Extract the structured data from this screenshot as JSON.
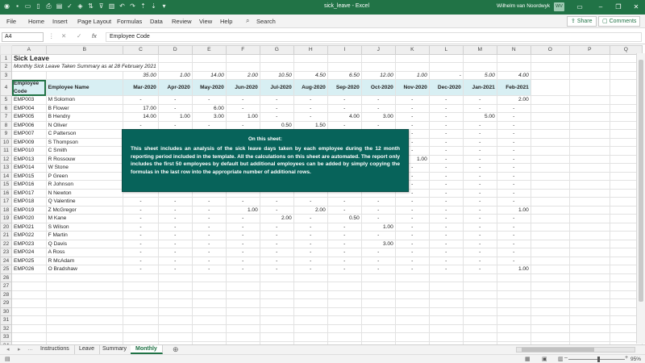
{
  "app": {
    "title": "sick_leave  -  Excel",
    "user_name": "Wilhelm van Noordwyk",
    "user_initials": "WV",
    "accent_color": "#217346"
  },
  "quick_access_icons": [
    "autosave-icon",
    "save-icon",
    "open-icon",
    "new-icon",
    "print-icon",
    "print-preview-icon",
    "spelling-icon",
    "format-icon",
    "sort-icon",
    "filter-icon",
    "chart-icon",
    "undo-icon",
    "redo-icon",
    "sort-asc-icon",
    "sort-desc-icon",
    "more-icon"
  ],
  "menu": {
    "items": [
      "File",
      "Home",
      "Insert",
      "Page Layout",
      "Formulas",
      "Data",
      "Review",
      "View",
      "Help"
    ],
    "search_label": "Search",
    "share_label": "Share",
    "comments_label": "Comments"
  },
  "formula_bar": {
    "name_box": "A4",
    "fx": "fx",
    "content": "Employee Code"
  },
  "columns": [
    "A",
    "B",
    "C",
    "D",
    "E",
    "F",
    "G",
    "H",
    "I",
    "J",
    "K",
    "L",
    "M",
    "N",
    "O",
    "P",
    "Q"
  ],
  "sheet": {
    "title": "Sick Leave",
    "subtitle": "Monthly Sick Leave Taken Summary as at 28 February 2021",
    "totals": [
      "35.00",
      "1.00",
      "14.00",
      "2.00",
      "10.50",
      "4.50",
      "6.50",
      "12.00",
      "1.00",
      "-",
      "5.00",
      "4.00"
    ],
    "header_code": "Employee Code",
    "header_name": "Employee Name",
    "months": [
      "Mar-2020",
      "Apr-2020",
      "May-2020",
      "Jun-2020",
      "Jul-2020",
      "Aug-2020",
      "Sep-2020",
      "Oct-2020",
      "Nov-2020",
      "Dec-2020",
      "Jan-2021",
      "Feb-2021"
    ],
    "employees": [
      {
        "code": "EMP003",
        "name": "M Solomon",
        "values": [
          "-",
          "-",
          "-",
          "-",
          "-",
          "-",
          "-",
          "-",
          "-",
          "-",
          "-",
          "2.00"
        ]
      },
      {
        "code": "EMP004",
        "name": "B Flower",
        "values": [
          "17.00",
          "-",
          "6.00",
          "-",
          "-",
          "-",
          "-",
          "-",
          "-",
          "-",
          "-",
          "-"
        ]
      },
      {
        "code": "EMP005",
        "name": "B Hendry",
        "values": [
          "14.00",
          "1.00",
          "3.00",
          "1.00",
          "-",
          "-",
          "4.00",
          "3.00",
          "-",
          "-",
          "5.00",
          "-"
        ]
      },
      {
        "code": "EMP006",
        "name": "N Oliver",
        "values": [
          "-",
          "-",
          "-",
          "-",
          "0.50",
          "1.50",
          "-",
          "-",
          "-",
          "-",
          "-",
          "-"
        ]
      },
      {
        "code": "EMP007",
        "name": "C Patterson",
        "values": [
          "",
          "",
          "",
          "",
          "",
          "",
          "",
          "",
          "-",
          "-",
          "-",
          "-"
        ]
      },
      {
        "code": "EMP009",
        "name": "S Thompson",
        "values": [
          "",
          "",
          "",
          "",
          "",
          "",
          "",
          "",
          "-",
          "-",
          "-",
          "-"
        ]
      },
      {
        "code": "EMP010",
        "name": "C Smith",
        "values": [
          "",
          "",
          "",
          "",
          "",
          "",
          "",
          "",
          "-",
          "-",
          "-",
          "-"
        ]
      },
      {
        "code": "EMP013",
        "name": "R Rossouw",
        "values": [
          "",
          "",
          "",
          "",
          "",
          "",
          "",
          "",
          "1.00",
          "-",
          "-",
          "-"
        ]
      },
      {
        "code": "EMP014",
        "name": "W Stone",
        "values": [
          "",
          "",
          "",
          "",
          "",
          "",
          "",
          "",
          "-",
          "-",
          "-",
          "-"
        ]
      },
      {
        "code": "EMP015",
        "name": "P Green",
        "values": [
          "",
          "",
          "",
          "",
          "",
          "",
          "",
          "",
          "-",
          "-",
          "-",
          "-"
        ]
      },
      {
        "code": "EMP016",
        "name": "R Johnson",
        "values": [
          "",
          "",
          "",
          "",
          "",
          "",
          "",
          "",
          "-",
          "-",
          "-",
          "-"
        ]
      },
      {
        "code": "EMP017",
        "name": "N Newton",
        "values": [
          "",
          "",
          "",
          "",
          "",
          "",
          "",
          "",
          "-",
          "-",
          "-",
          "-"
        ]
      },
      {
        "code": "EMP018",
        "name": "Q Valentine",
        "values": [
          "-",
          "-",
          "-",
          "-",
          "-",
          "-",
          "-",
          "-",
          "-",
          "-",
          "-",
          "-"
        ]
      },
      {
        "code": "EMP019",
        "name": "Z McGregor",
        "values": [
          "-",
          "-",
          "-",
          "1.00",
          "-",
          "2.00",
          "-",
          "-",
          "-",
          "-",
          "-",
          "1.00"
        ]
      },
      {
        "code": "EMP020",
        "name": "M Kane",
        "values": [
          "-",
          "-",
          "-",
          "-",
          "2.00",
          "-",
          "0.50",
          "-",
          "-",
          "-",
          "-",
          "-"
        ]
      },
      {
        "code": "EMP021",
        "name": "S Wilson",
        "values": [
          "-",
          "-",
          "-",
          "-",
          "-",
          "-",
          "-",
          "1.00",
          "-",
          "-",
          "-",
          "-"
        ]
      },
      {
        "code": "EMP022",
        "name": "F Martin",
        "values": [
          "-",
          "-",
          "-",
          "-",
          "-",
          "-",
          "-",
          "-",
          "-",
          "-",
          "-",
          "-"
        ]
      },
      {
        "code": "EMP023",
        "name": "Q Davis",
        "values": [
          "-",
          "-",
          "-",
          "-",
          "-",
          "-",
          "-",
          "3.00",
          "-",
          "-",
          "-",
          "-"
        ]
      },
      {
        "code": "EMP024",
        "name": "A Ross",
        "values": [
          "-",
          "-",
          "-",
          "-",
          "-",
          "-",
          "-",
          "-",
          "-",
          "-",
          "-",
          "-"
        ]
      },
      {
        "code": "EMP025",
        "name": "R McAdam",
        "values": [
          "-",
          "-",
          "-",
          "-",
          "-",
          "-",
          "-",
          "-",
          "-",
          "-",
          "-",
          "-"
        ]
      },
      {
        "code": "EMP026",
        "name": "O Bradshaw",
        "values": [
          "-",
          "-",
          "-",
          "-",
          "-",
          "-",
          "-",
          "-",
          "-",
          "-",
          "-",
          "1.00"
        ]
      }
    ],
    "empty_rows": [
      26,
      27,
      28,
      29,
      30,
      31,
      32,
      33,
      34
    ]
  },
  "note": {
    "title": "On this sheet:",
    "body": "This sheet includes an analysis of the sick leave days taken by each employee during the 12 month reporting period included in the template. All the calculations on this sheet are automated. The report only includes the first 50 employees by default but additional employees can be added by simply copying the formulas in the last row into the appropriate number of additional rows."
  },
  "tabs": [
    "Instructions",
    "Leave",
    "Summary",
    "Monthly"
  ],
  "active_tab": "Monthly",
  "zoom": "95%"
}
